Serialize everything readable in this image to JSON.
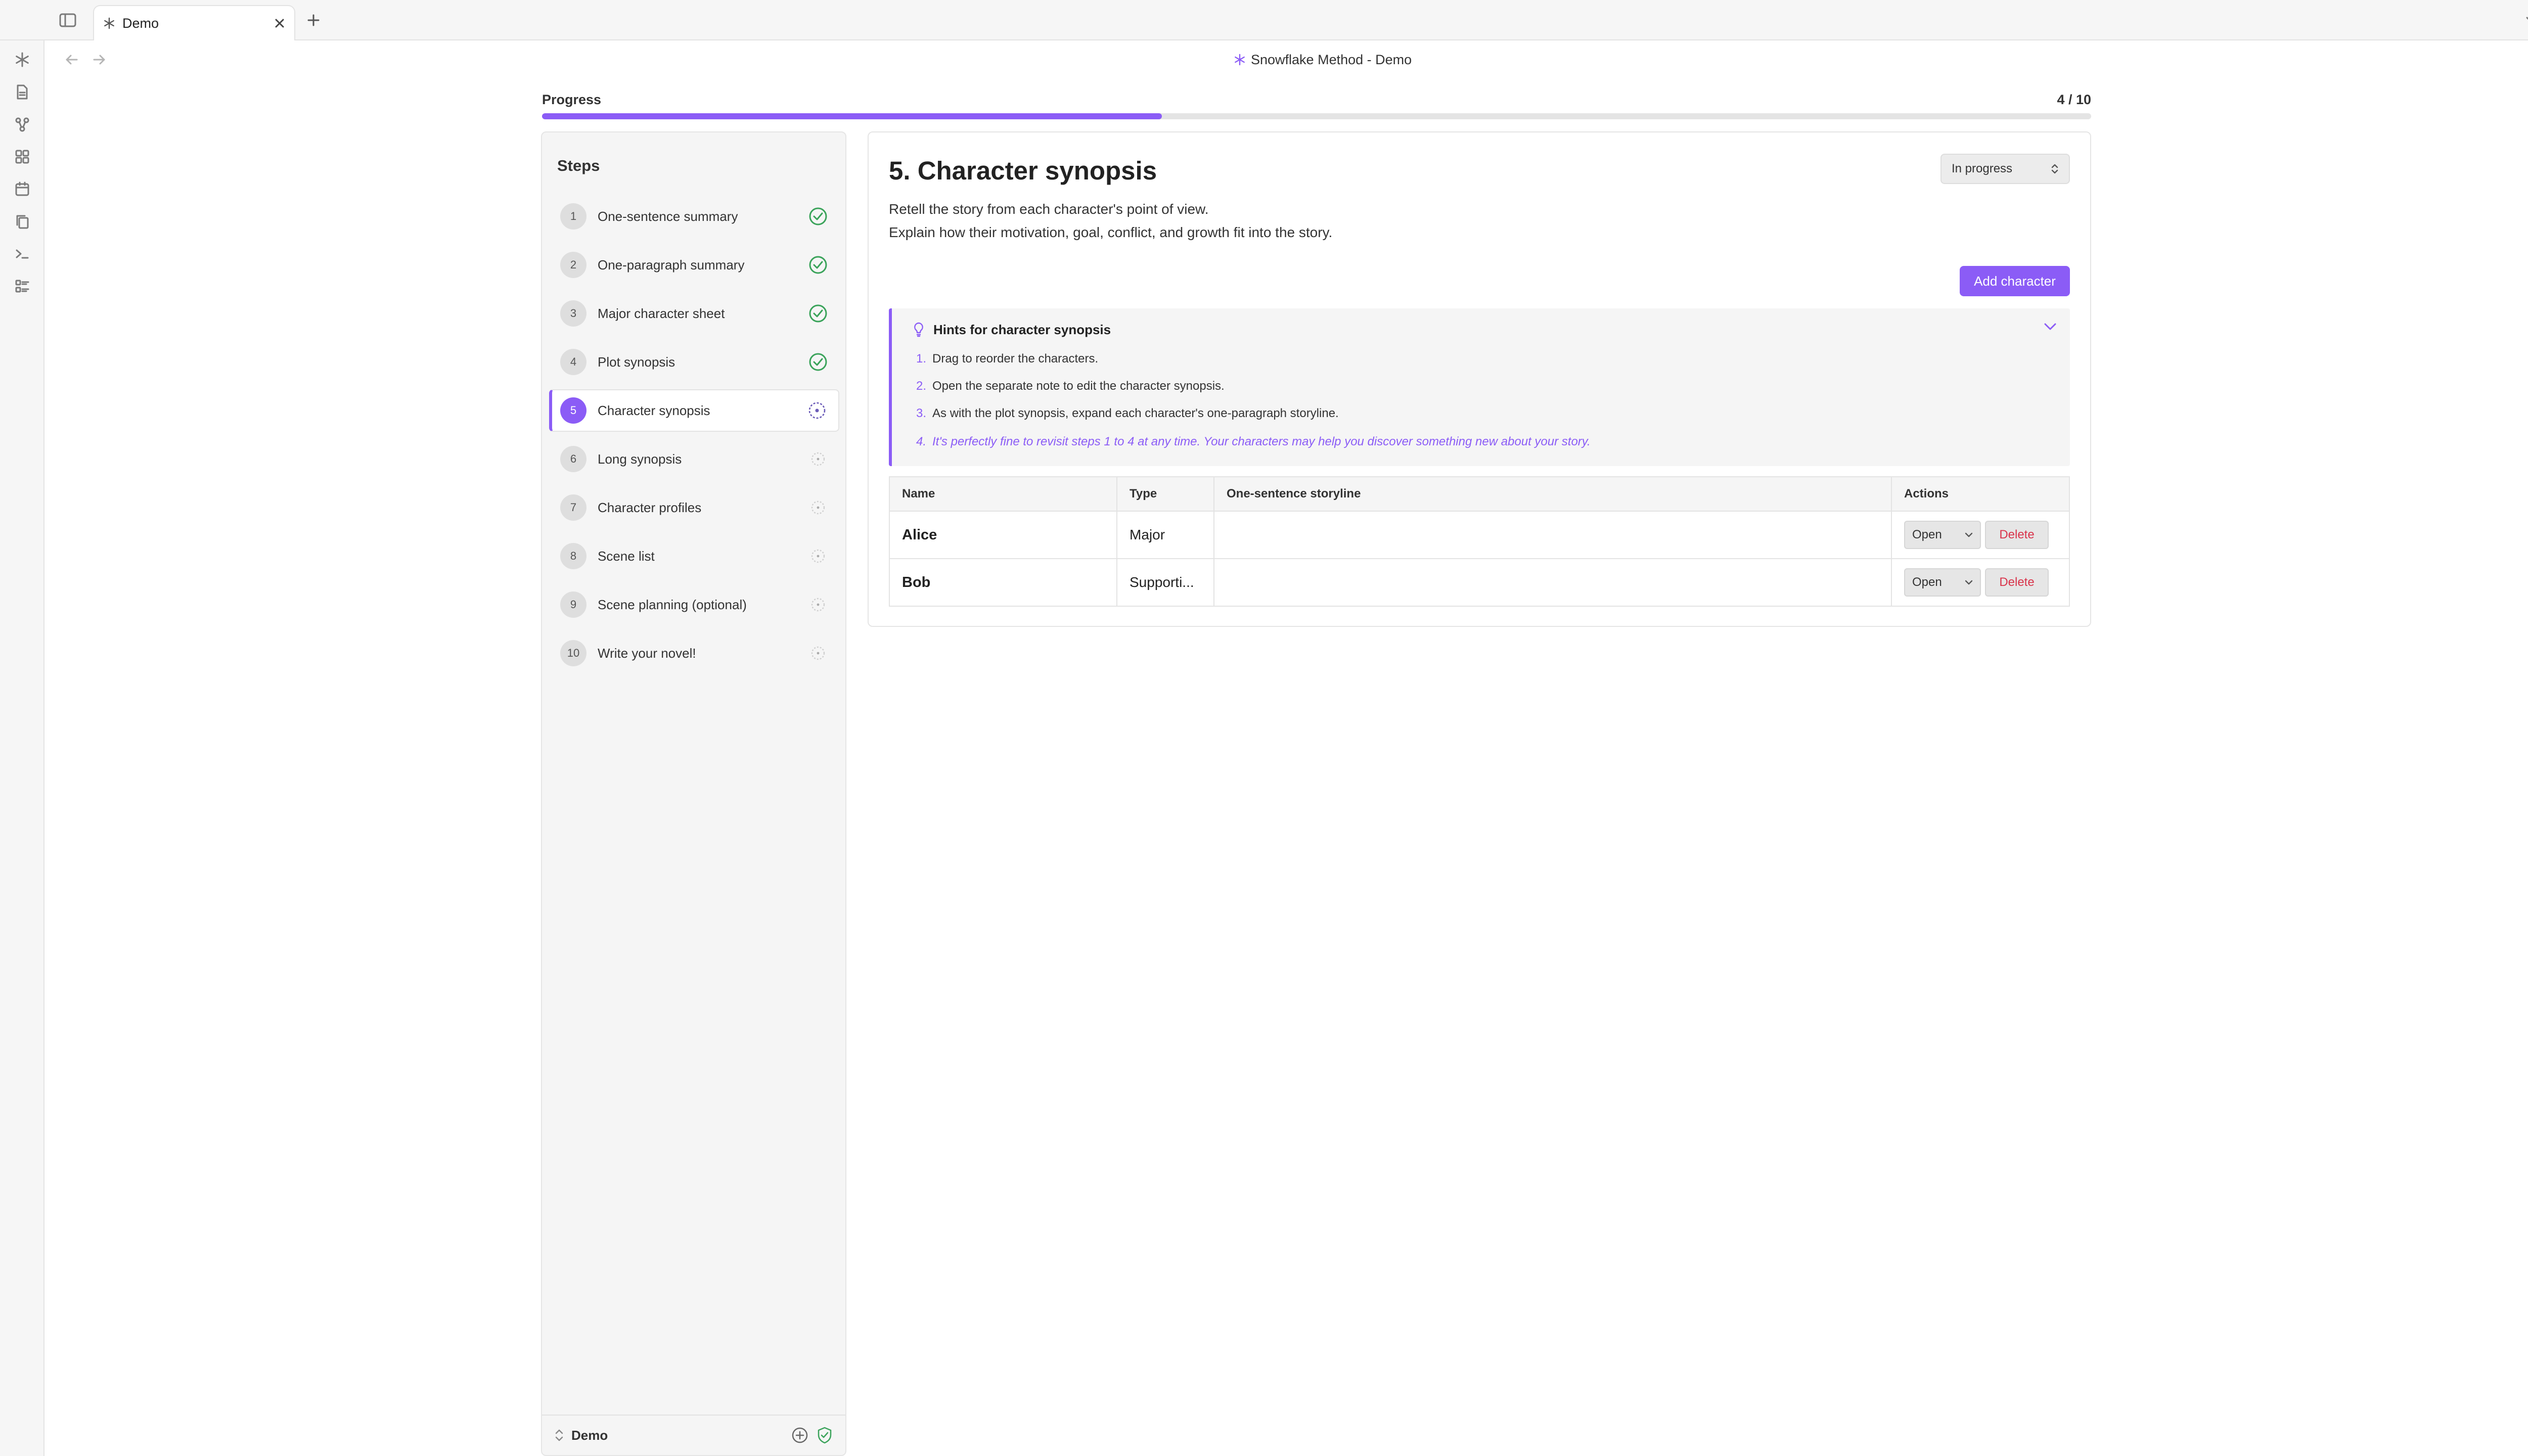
{
  "tab": {
    "title": "Demo"
  },
  "header": {
    "title": "Snowflake Method - Demo"
  },
  "progress": {
    "label": "Progress",
    "count": "4 / 10",
    "fraction": 0.4
  },
  "steps": {
    "title": "Steps",
    "items": [
      {
        "num": "1",
        "label": "One-sentence summary",
        "status": "done"
      },
      {
        "num": "2",
        "label": "One-paragraph summary",
        "status": "done"
      },
      {
        "num": "3",
        "label": "Major character sheet",
        "status": "done"
      },
      {
        "num": "4",
        "label": "Plot synopsis",
        "status": "done"
      },
      {
        "num": "5",
        "label": "Character synopsis",
        "status": "in-progress"
      },
      {
        "num": "6",
        "label": "Long synopsis",
        "status": "todo"
      },
      {
        "num": "7",
        "label": "Character profiles",
        "status": "todo"
      },
      {
        "num": "8",
        "label": "Scene list",
        "status": "todo"
      },
      {
        "num": "9",
        "label": "Scene planning (optional)",
        "status": "todo"
      },
      {
        "num": "10",
        "label": "Write your novel!",
        "status": "todo"
      }
    ],
    "footer_label": "Demo"
  },
  "main": {
    "title": "5. Character synopsis",
    "status_value": "In progress",
    "description": [
      "Retell the story from each character's point of view.",
      "Explain how their motivation, goal, conflict, and growth fit into the story."
    ],
    "add_button": "Add character",
    "hints": {
      "title": "Hints for character synopsis",
      "items": [
        {
          "n": "1.",
          "text": "Drag to reorder the characters."
        },
        {
          "n": "2.",
          "text": "Open the separate note to edit the character synopsis."
        },
        {
          "n": "3.",
          "text": "As with the plot synopsis, expand each character's one-paragraph storyline."
        },
        {
          "n": "4.",
          "text": "It's perfectly fine to revisit steps 1 to 4 at any time. Your characters may help you discover something new about your story."
        }
      ]
    },
    "table": {
      "headers": [
        "Name",
        "Type",
        "One-sentence storyline",
        "Actions"
      ],
      "rows": [
        {
          "name": "Alice",
          "type": "Major",
          "storyline": "",
          "open": "Open",
          "delete": "Delete"
        },
        {
          "name": "Bob",
          "type": "Supporti...",
          "storyline": "",
          "open": "Open",
          "delete": "Delete"
        }
      ]
    }
  },
  "colors": {
    "accent": "#8b5cf6",
    "done": "#3aa35a",
    "danger": "#d9334a"
  }
}
